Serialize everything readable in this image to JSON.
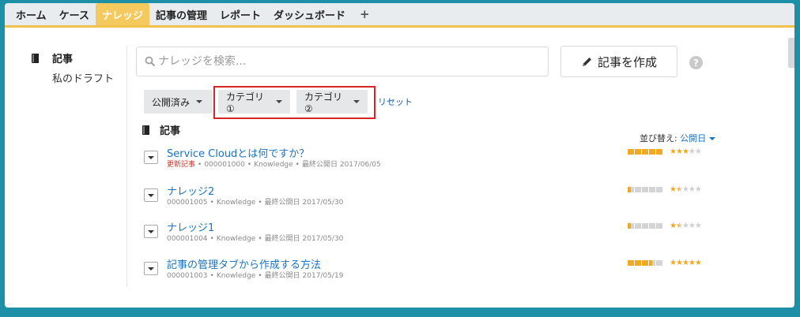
{
  "tabs": [
    {
      "label": "ホーム"
    },
    {
      "label": "ケース"
    },
    {
      "label": "ナレッジ",
      "active": true
    },
    {
      "label": "記事の管理"
    },
    {
      "label": "レポート"
    },
    {
      "label": "ダッシュボード"
    },
    {
      "label": "+"
    }
  ],
  "sidebar": {
    "title": "記事",
    "sub": "私のドラフト"
  },
  "search": {
    "placeholder": "ナレッジを検索..."
  },
  "create_button": "記事を作成",
  "help": "?",
  "filters": [
    {
      "label": "公開済み"
    },
    {
      "label": "カテゴリ①"
    },
    {
      "label": "カテゴリ②"
    }
  ],
  "reset": "リセット",
  "section_title": "記事",
  "sort": {
    "label": "並び替え:",
    "value": "公開日"
  },
  "articles": [
    {
      "title": "Service Cloudとは何ですか？",
      "badge": "更新記事",
      "number": "000001000",
      "type": "Knowledge",
      "date": "最終公開日 2017/06/05",
      "bars": 5,
      "stars": 3
    },
    {
      "title": "ナレッジ2",
      "badge": "",
      "number": "000001005",
      "type": "Knowledge",
      "date": "最終公開日 2017/05/30",
      "bars": 0.5,
      "stars": 1.5
    },
    {
      "title": "ナレッジ1",
      "badge": "",
      "number": "000001004",
      "type": "Knowledge",
      "date": "最終公開日 2017/05/30",
      "bars": 0.5,
      "stars": 1.5
    },
    {
      "title": "記事の管理タブから作成する方法",
      "badge": "",
      "number": "000001003",
      "type": "Knowledge",
      "date": "最終公開日 2017/05/19",
      "bars": 3.5,
      "stars": 5
    }
  ],
  "colors": {
    "accent": "#f4c95d",
    "link": "#1a73c0",
    "highlight": "#d8232a",
    "rating": "#f0a923"
  }
}
